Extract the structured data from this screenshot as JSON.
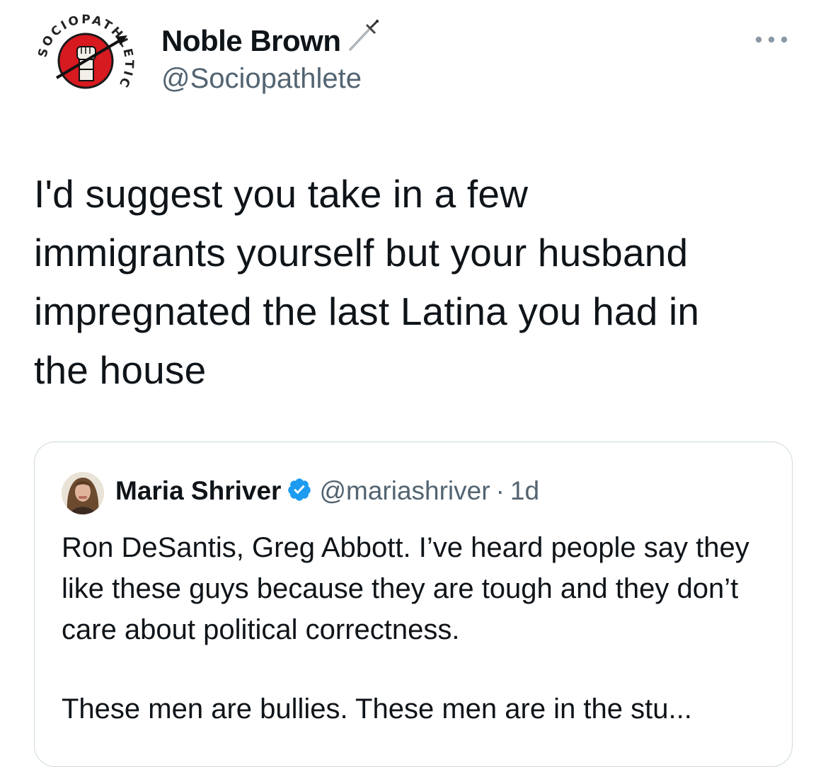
{
  "author": {
    "display_name": "Noble Brown",
    "handle": "@Sociopathlete",
    "avatar_ring_text": "SOCIOPATHLETIC",
    "avatar_icon": "raised-fist-logo",
    "name_emoji_icon": "sword-icon"
  },
  "tweet": {
    "text": "I'd suggest you take in a few\nimmigrants yourself but your husband\nimpregnated the last Latina you had in\nthe house"
  },
  "more_icon": "more-dots-icon",
  "quoted": {
    "display_name": "Maria Shriver",
    "verified_icon": "verified-badge-icon",
    "handle": "@mariashriver",
    "separator": "·",
    "time": "1d",
    "paragraph1": "Ron DeSantis, Greg Abbott. I’ve heard people say they like these guys because they are tough and they don’t care about political correctness.",
    "paragraph2": "These men are bullies. These men are in the stu..."
  },
  "colors": {
    "text": "#0f1419",
    "secondary": "#536471",
    "border": "#cfd9de",
    "verified": "#1d9bf0",
    "logo_red": "#d71920"
  }
}
